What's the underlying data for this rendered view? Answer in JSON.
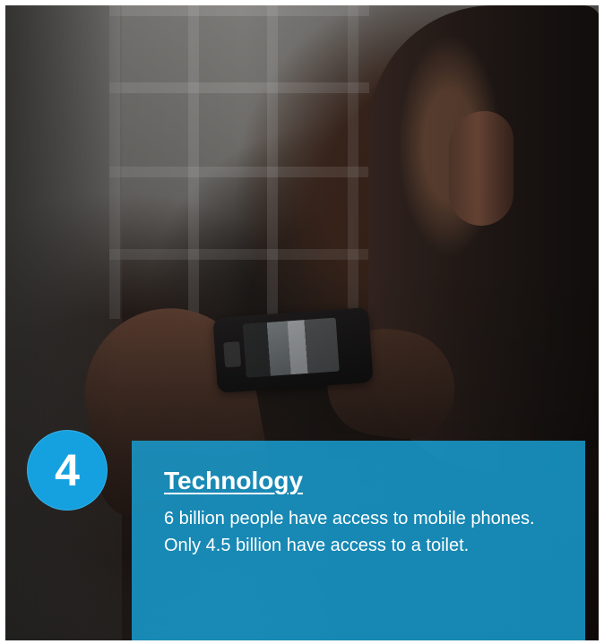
{
  "badge": {
    "number": "4"
  },
  "panel": {
    "title": "Technology",
    "body": "6 billion people have access to mobile phones. Only 4.5 billion have access to a toilet."
  },
  "colors": {
    "accent": "#15A1DF",
    "panel": "#18A0D4"
  }
}
